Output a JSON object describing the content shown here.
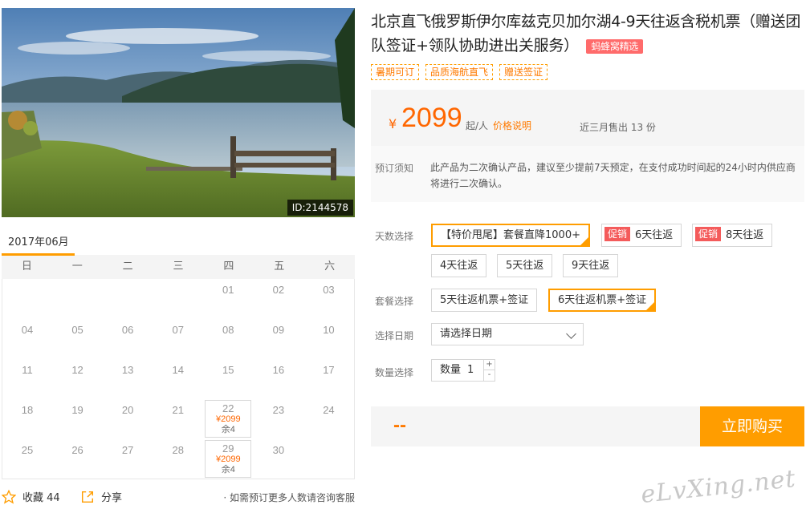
{
  "product": {
    "title": "北京直飞俄罗斯伊尔库兹克贝加尔湖4-9天往返含税机票（赠送团队签证+领队协助进出关服务）",
    "pick_tag": "蚂蜂窝精选",
    "features": [
      "暑期可订",
      "品质海航直飞",
      "赠送签证"
    ],
    "photo_id": "ID:2144578"
  },
  "price": {
    "currency": "¥",
    "value": "2099",
    "unit": "起/人",
    "note_link": "价格说明",
    "sold": "近三月售出 13 份"
  },
  "notice": {
    "label": "预订须知",
    "text": "此产品为二次确认产品，建议至少提前7天预定，在支付成功时间起的24小时内供应商将进行二次确认。"
  },
  "options": {
    "days_label": "天数选择",
    "days": [
      {
        "label": "【特价甩尾】套餐直降1000+",
        "selected": true,
        "promo": ""
      },
      {
        "label": "6天往返",
        "selected": false,
        "promo": "促销"
      },
      {
        "label": "8天往返",
        "selected": false,
        "promo": "促销"
      },
      {
        "label": "4天往返",
        "selected": false,
        "promo": ""
      },
      {
        "label": "5天往返",
        "selected": false,
        "promo": ""
      },
      {
        "label": "9天往返",
        "selected": false,
        "promo": ""
      }
    ],
    "package_label": "套餐选择",
    "packages": [
      {
        "label": "5天往返机票+签证",
        "selected": false
      },
      {
        "label": "6天往返机票+签证",
        "selected": true
      }
    ],
    "date_label": "选择日期",
    "date_placeholder": "请选择日期",
    "qty_label": "数量选择",
    "qty_text": "数量",
    "qty_value": "1",
    "qty_plus": "+",
    "qty_minus": "-"
  },
  "buy": {
    "total": "--",
    "button": "立即购买"
  },
  "calendar": {
    "month": "2017年06月",
    "weekdays": [
      "日",
      "一",
      "二",
      "三",
      "四",
      "五",
      "六"
    ],
    "weeks": [
      [
        null,
        null,
        null,
        null,
        "01",
        "02",
        "03"
      ],
      [
        "04",
        "05",
        "06",
        "07",
        "08",
        "09",
        "10"
      ],
      [
        "11",
        "12",
        "13",
        "14",
        "15",
        "16",
        "17"
      ],
      [
        "18",
        "19",
        "20",
        "21",
        "22",
        "23",
        "24"
      ],
      [
        "25",
        "26",
        "27",
        "28",
        "29",
        "30",
        null
      ]
    ],
    "available": {
      "22": {
        "price": "¥2099",
        "remain": "余4"
      },
      "29": {
        "price": "¥2099",
        "remain": "余4"
      }
    }
  },
  "actions": {
    "favorite": "收藏 44",
    "share": "分享",
    "consult": "· 如需预订更多人数请咨询客服"
  },
  "watermark": "eLvXing.net",
  "colors": {
    "accent": "#ff9d00",
    "price": "#ff6600",
    "promo": "#f45b5b"
  }
}
